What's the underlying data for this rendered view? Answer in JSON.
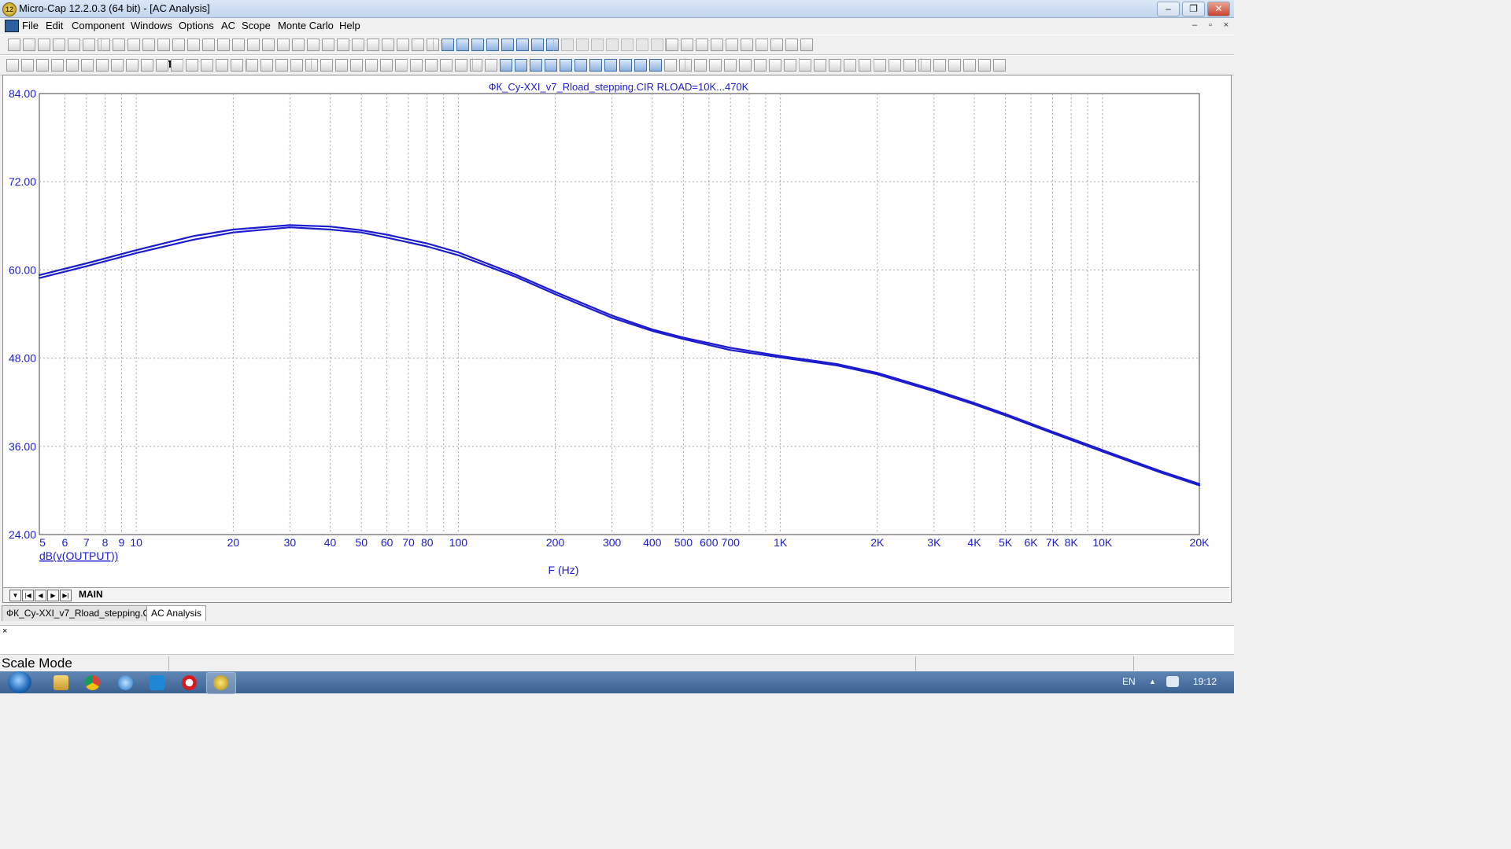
{
  "window": {
    "title": "Micro-Cap 12.2.0.3 (64 bit) - [AC Analysis]",
    "app_icon_label": "12",
    "controls": [
      "minimize",
      "restore",
      "close"
    ]
  },
  "menu": {
    "items": [
      "File",
      "Edit",
      "Component",
      "Windows",
      "Options",
      "AC",
      "Scope",
      "Monte Carlo",
      "Help"
    ]
  },
  "plot": {
    "text_tool_glyph": "T",
    "font_tool_glyph": "A",
    "title": "ФК_Cy-XXI_v7_Rload_stepping.CIR RLOAD=10K...470K",
    "expression": "dB(v(OUTPUT))",
    "xlabel": "F (Hz)"
  },
  "chart_data": {
    "type": "line",
    "title": "ФК_Cy-XXI_v7_Rload_stepping.CIR RLOAD=10K...470K",
    "xlabel": "F (Hz)",
    "ylabel": "dB(v(OUTPUT))",
    "x_scale": "log",
    "xlim": [
      5,
      20000
    ],
    "ylim": [
      24,
      84
    ],
    "grid": true,
    "line_color": "#1c1ccf",
    "y_ticks": [
      "84.00",
      "72.00",
      "60.00",
      "48.00",
      "36.00",
      "24.00"
    ],
    "y_tick_values": [
      84,
      72,
      60,
      48,
      36,
      24
    ],
    "x_ticks": [
      {
        "v": 5,
        "t": "5"
      },
      {
        "v": 6,
        "t": "6"
      },
      {
        "v": 7,
        "t": "7"
      },
      {
        "v": 8,
        "t": "8"
      },
      {
        "v": 9,
        "t": "9"
      },
      {
        "v": 10,
        "t": "10"
      },
      {
        "v": 20,
        "t": "20"
      },
      {
        "v": 30,
        "t": "30"
      },
      {
        "v": 40,
        "t": "40"
      },
      {
        "v": 50,
        "t": "50"
      },
      {
        "v": 60,
        "t": "60"
      },
      {
        "v": 70,
        "t": "70"
      },
      {
        "v": 80,
        "t": "80"
      },
      {
        "v": 100,
        "t": "100"
      },
      {
        "v": 200,
        "t": "200"
      },
      {
        "v": 300,
        "t": "300"
      },
      {
        "v": 400,
        "t": "400"
      },
      {
        "v": 500,
        "t": "500"
      },
      {
        "v": 600,
        "t": "600"
      },
      {
        "v": 700,
        "t": "700"
      },
      {
        "v": 1000,
        "t": "1K"
      },
      {
        "v": 2000,
        "t": "2K"
      },
      {
        "v": 3000,
        "t": "3K"
      },
      {
        "v": 4000,
        "t": "4K"
      },
      {
        "v": 5000,
        "t": "5K"
      },
      {
        "v": 6000,
        "t": "6K"
      },
      {
        "v": 7000,
        "t": "7K"
      },
      {
        "v": 8000,
        "t": "8K"
      },
      {
        "v": 10000,
        "t": "10K"
      },
      {
        "v": 20000,
        "t": "20K"
      }
    ],
    "series": [
      {
        "x": [
          5,
          7,
          10,
          15,
          20,
          30,
          40,
          50,
          60,
          80,
          100,
          150,
          200,
          300,
          400,
          500,
          700,
          1000,
          1500,
          2000,
          3000,
          4000,
          5000,
          7000,
          10000,
          15000,
          20000
        ],
        "y": [
          59.3,
          60.9,
          62.7,
          64.6,
          65.5,
          66.1,
          65.9,
          65.4,
          64.8,
          63.6,
          62.4,
          59.4,
          57.0,
          53.8,
          51.9,
          50.8,
          49.4,
          48.3,
          47.2,
          46.0,
          43.7,
          41.9,
          40.4,
          38.0,
          35.5,
          32.7,
          30.9
        ]
      },
      {
        "x": [
          5,
          7,
          10,
          15,
          20,
          30,
          40,
          50,
          60,
          80,
          100,
          150,
          200,
          300,
          400,
          500,
          700,
          1000,
          1500,
          2000,
          3000,
          4000,
          5000,
          7000,
          10000,
          15000,
          20000
        ],
        "y": [
          58.9,
          60.5,
          62.3,
          64.1,
          65.1,
          65.8,
          65.5,
          65.1,
          64.4,
          63.2,
          62.0,
          59.1,
          56.7,
          53.5,
          51.7,
          50.6,
          49.1,
          48.1,
          47.0,
          45.8,
          43.5,
          41.7,
          40.2,
          37.8,
          35.3,
          32.5,
          30.7
        ]
      }
    ]
  },
  "plot_tabs": {
    "nav_buttons": [
      "▼",
      "|◀",
      "◀",
      "▶",
      "▶|"
    ],
    "active": "MAIN"
  },
  "doc_tabs": [
    "ФК_Cy-XXI_v7_Rload_stepping.CIR",
    "AC Analysis"
  ],
  "command": {
    "close_glyph": "×"
  },
  "status": {
    "mode": "Scale Mode"
  },
  "taskbar": {
    "language": "EN",
    "time": "19:12",
    "tray_arrow": "▲"
  }
}
